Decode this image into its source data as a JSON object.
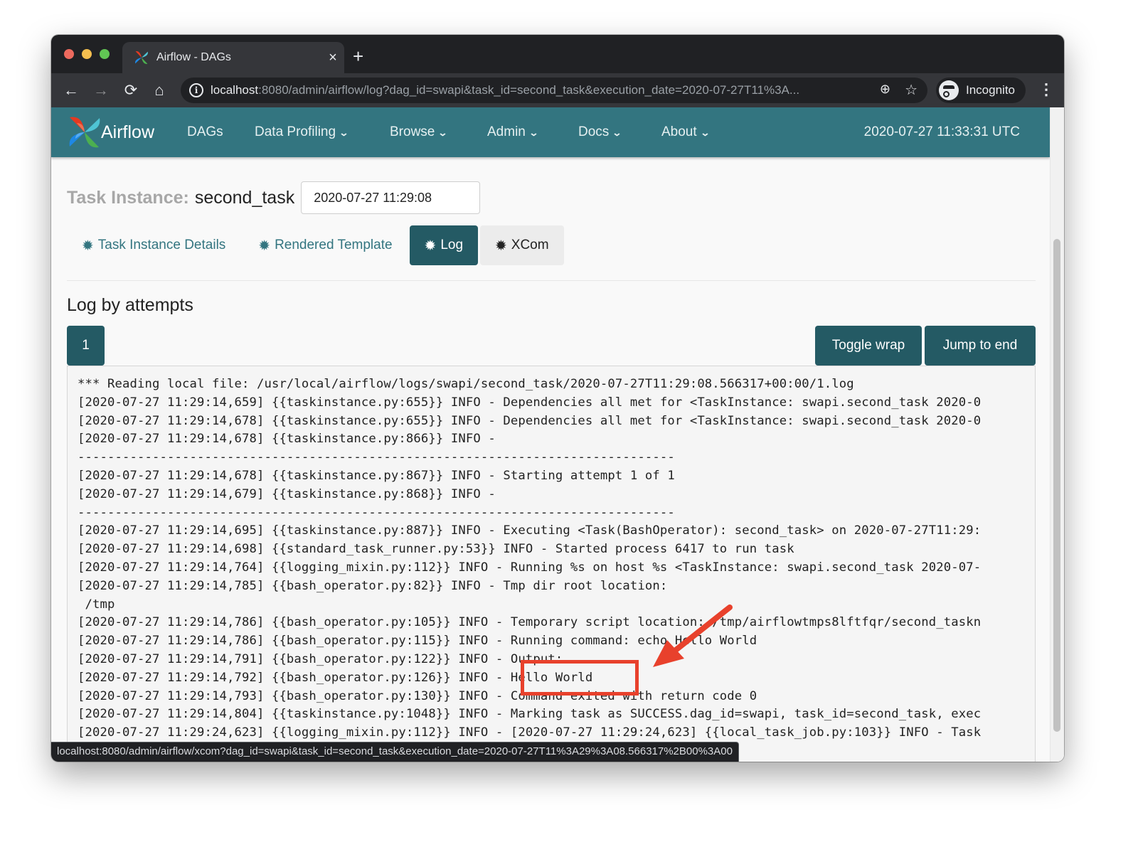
{
  "browser": {
    "tab_title": "Airflow - DAGs",
    "tab_close": "×",
    "new_tab": "+",
    "nav": {
      "back": "←",
      "forward": "→",
      "reload": "⟳",
      "home": "⌂"
    },
    "url_host": "localhost",
    "url_rest": ":8080/admin/airflow/log?dag_id=swapi&task_id=second_task&execution_date=2020-07-27T11%3A...",
    "zoom_icon": "⊕",
    "bookmark_icon": "☆",
    "profile_label": "Incognito",
    "menu_icon": "⋮",
    "status_url": "localhost:8080/admin/airflow/xcom?dag_id=swapi&task_id=second_task&execution_date=2020-07-27T11%3A29%3A08.566317%2B00%3A00"
  },
  "navbar": {
    "brand": "Airflow",
    "items": [
      {
        "label": "DAGs",
        "dropdown": false
      },
      {
        "label": "Data Profiling",
        "dropdown": true
      },
      {
        "label": "Browse",
        "dropdown": true
      },
      {
        "label": "Admin",
        "dropdown": true
      },
      {
        "label": "Docs",
        "dropdown": true
      },
      {
        "label": "About",
        "dropdown": true
      }
    ],
    "chevron": "❯",
    "clock": "2020-07-27 11:33:31 UTC",
    "brand_colors": {
      "red": "#e43921",
      "teal": "#4fc4d4",
      "blue": "#1e88e5",
      "green": "#4caf50"
    }
  },
  "task_instance": {
    "label": "Task Instance:",
    "name": "second_task",
    "execution_date": "2020-07-27 11:29:08",
    "tabs": [
      {
        "label": "Task Instance Details",
        "active": false
      },
      {
        "label": "Rendered Template",
        "active": false
      },
      {
        "label": "Log",
        "active": true
      },
      {
        "label": "XCom",
        "active": false
      }
    ],
    "tab_icon": "✹"
  },
  "log": {
    "heading": "Log by attempts",
    "attempts": [
      "1"
    ],
    "toggle_wrap_label": "Toggle wrap",
    "jump_to_end_label": "Jump to end",
    "lines": [
      "*** Reading local file: /usr/local/airflow/logs/swapi/second_task/2020-07-27T11:29:08.566317+00:00/1.log",
      "[2020-07-27 11:29:14,659] {{taskinstance.py:655}} INFO - Dependencies all met for <TaskInstance: swapi.second_task 2020-0",
      "[2020-07-27 11:29:14,678] {{taskinstance.py:655}} INFO - Dependencies all met for <TaskInstance: swapi.second_task 2020-0",
      "[2020-07-27 11:29:14,678] {{taskinstance.py:866}} INFO - ",
      "--------------------------------------------------------------------------------",
      "[2020-07-27 11:29:14,678] {{taskinstance.py:867}} INFO - Starting attempt 1 of 1",
      "[2020-07-27 11:29:14,679] {{taskinstance.py:868}} INFO - ",
      "--------------------------------------------------------------------------------",
      "[2020-07-27 11:29:14,695] {{taskinstance.py:887}} INFO - Executing <Task(BashOperator): second_task> on 2020-07-27T11:29:",
      "[2020-07-27 11:29:14,698] {{standard_task_runner.py:53}} INFO - Started process 6417 to run task",
      "[2020-07-27 11:29:14,764] {{logging_mixin.py:112}} INFO - Running %s on host %s <TaskInstance: swapi.second_task 2020-07-",
      "[2020-07-27 11:29:14,785] {{bash_operator.py:82}} INFO - Tmp dir root location: ",
      " /tmp",
      "[2020-07-27 11:29:14,786] {{bash_operator.py:105}} INFO - Temporary script location: /tmp/airflowtmps8lftfqr/second_taskn",
      "[2020-07-27 11:29:14,786] {{bash_operator.py:115}} INFO - Running command: echo Hello World",
      "[2020-07-27 11:29:14,791] {{bash_operator.py:122}} INFO - Output:",
      "[2020-07-27 11:29:14,792] {{bash_operator.py:126}} INFO - Hello World",
      "[2020-07-27 11:29:14,793] {{bash_operator.py:130}} INFO - Command exited with return code 0",
      "[2020-07-27 11:29:14,804] {{taskinstance.py:1048}} INFO - Marking task as SUCCESS.dag_id=swapi, task_id=second_task, exec",
      "[2020-07-27 11:29:24,623] {{logging_mixin.py:112}} INFO - [2020-07-27 11:29:24,623] {{local_task_job.py:103}} INFO - Task"
    ]
  },
  "annotation": {
    "highlighted_text": "Hello World",
    "color": "#e8412c"
  }
}
